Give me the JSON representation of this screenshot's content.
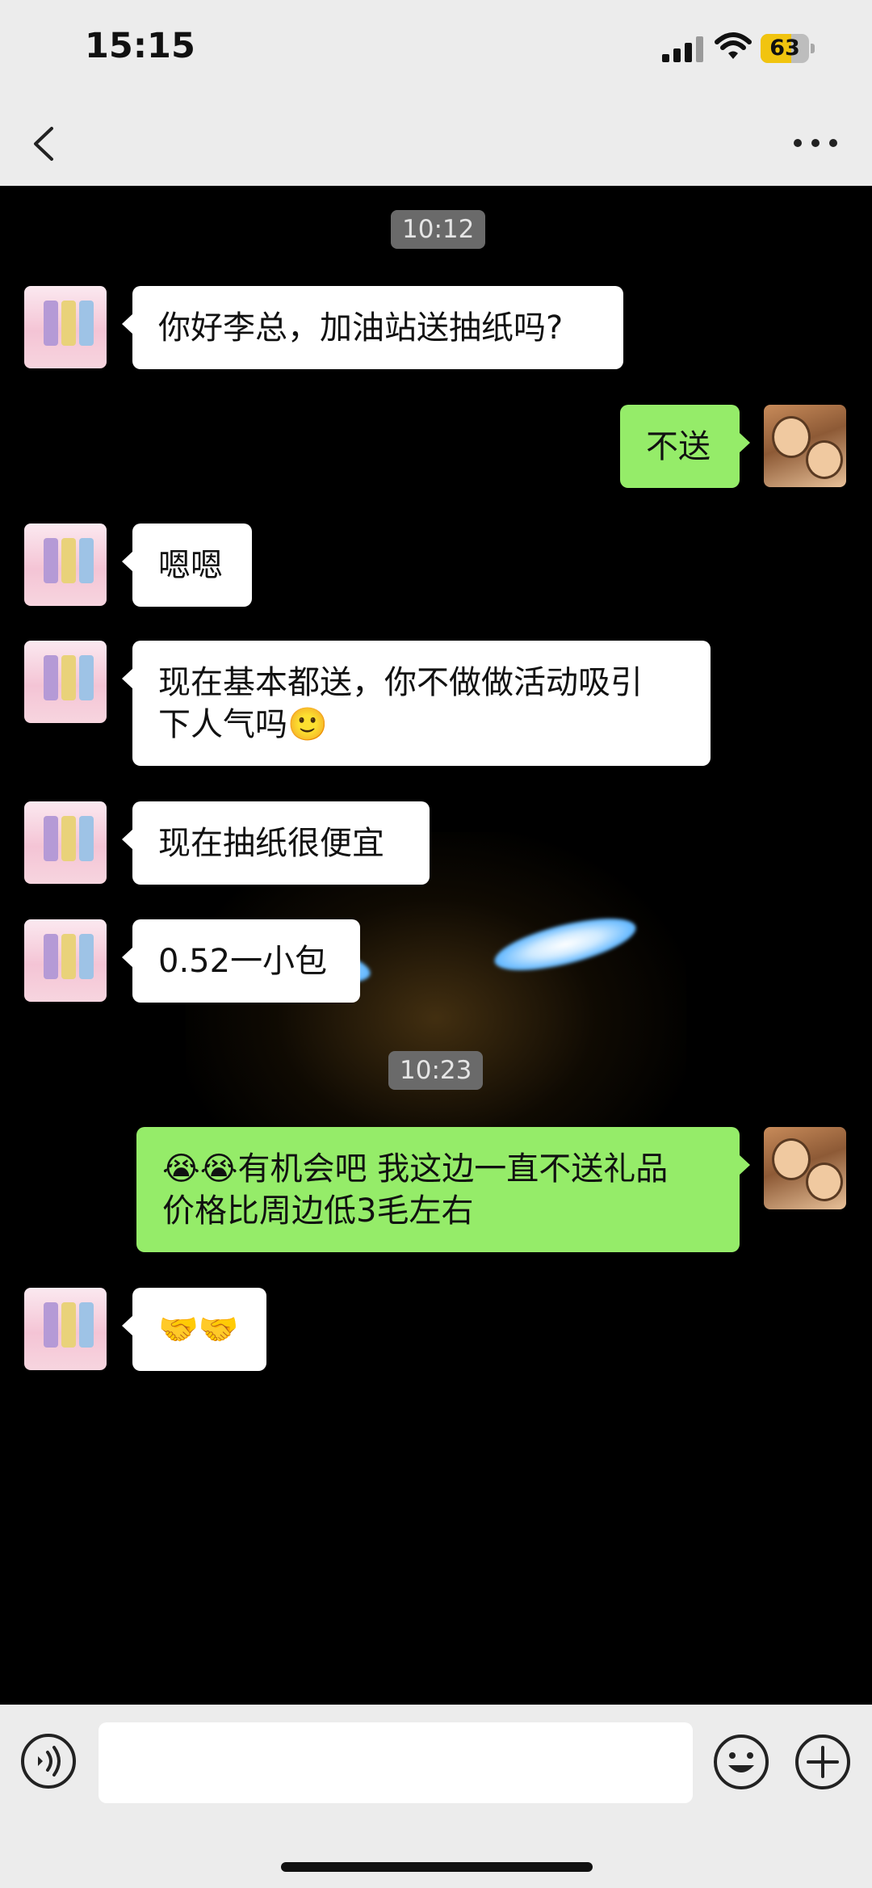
{
  "status_bar": {
    "time": "15:15",
    "battery": "63",
    "battery_level": 0.63
  },
  "chat": {
    "timestamps": [
      "10:12",
      "10:23"
    ],
    "messages": [
      {
        "side": "left",
        "text": "你好李总，加油站送抽纸吗?"
      },
      {
        "side": "right",
        "text": "不送"
      },
      {
        "side": "left",
        "text": "嗯嗯"
      },
      {
        "side": "left",
        "line1": "现在基本都送，你不做做活动吸引",
        "line2": "下人气吗🙂"
      },
      {
        "side": "left",
        "text": "现在抽纸很便宜"
      },
      {
        "side": "left",
        "text": "0.52一小包"
      },
      {
        "side": "right",
        "line1": "😭😭有机会吧 我这边一直不送礼品",
        "line2": "价格比周边低3毛左右"
      },
      {
        "side": "left",
        "text": "🤝🤝"
      }
    ]
  },
  "colors": {
    "sent_bubble": "#95ec69",
    "received_bubble": "#ffffff",
    "bars": "#ececec"
  },
  "icons": [
    "back-chevron-icon",
    "more-icon",
    "voice-icon",
    "emoji-icon",
    "plus-icon"
  ]
}
